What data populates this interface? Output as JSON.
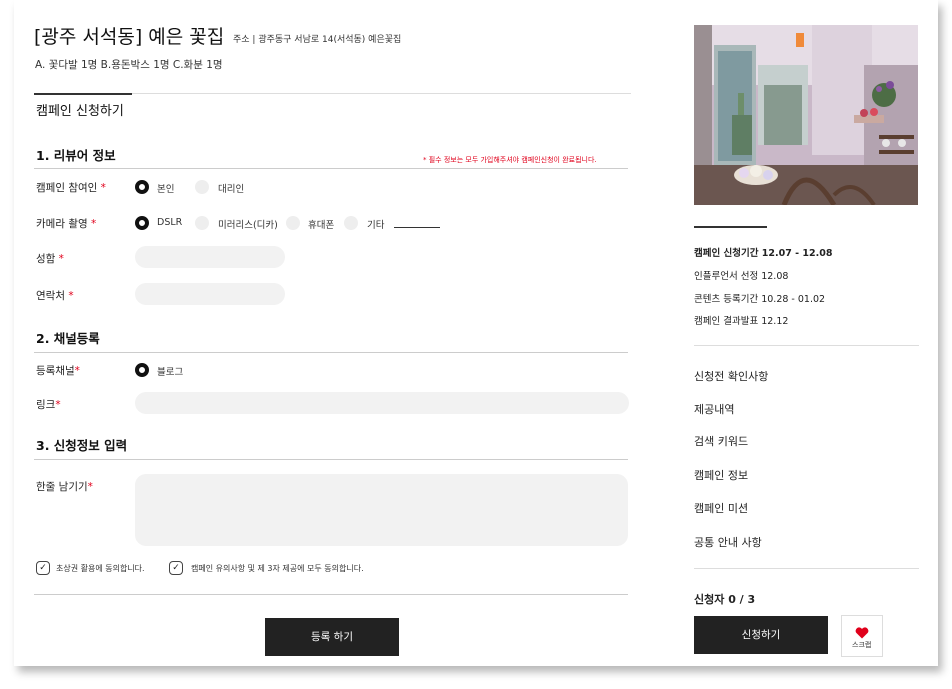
{
  "header": {
    "title": "[광주 서석동] 예은 꽃집",
    "address": "주소 | 광주동구 서남로 14(서석동) 예은꽃집",
    "rewards": "A. 꽃다발 1명 B.용돈박스 1명 C.화분 1명"
  },
  "tab_label": "캠페인 신청하기",
  "section1": {
    "heading": "1. 리뷰어 정보",
    "required_note": "* 필수 정보는 모두 가입해주셔야 캠페인신청이 완료됩니다.",
    "participant": {
      "label": "캠페인 참여인",
      "options": [
        "본인",
        "대리인"
      ],
      "selected": "본인"
    },
    "camera": {
      "label": "카메라 촬영",
      "options": [
        "DSLR",
        "미러리스(디카)",
        "휴대폰",
        "기타"
      ],
      "selected": "DSLR"
    },
    "name_label": "성함",
    "phone_label": "연락처",
    "required_mark": "*"
  },
  "section2": {
    "heading": "2. 채널등록",
    "channel": {
      "label": "등록채널",
      "option": "블로그"
    },
    "link_label": "링크"
  },
  "section3": {
    "heading": "3. 신청정보 입력",
    "comment_label": "한줄 남기기"
  },
  "agreements": [
    "초상권 활용에 동의합니다.",
    "캠페인 유의사항 및 제 3자 제공에 모두 동의합니다."
  ],
  "submit_label": "등록 하기",
  "sidebar": {
    "schedule": [
      {
        "label": "캠페인 신청기간 12.07 - 12.08",
        "bold": true
      },
      {
        "label": "인플루언서 선정 12.08",
        "bold": false
      },
      {
        "label": "콘텐츠 등록기간 10.28 - 01.02",
        "bold": false
      },
      {
        "label": "캠페인 결과발표 12.12",
        "bold": false
      }
    ],
    "menu": [
      "신청전 확인사항",
      "제공내역",
      "검색 키워드",
      "캠페인 정보",
      "캠페인 미션",
      "공통 안내 사항"
    ],
    "applicants": "신청자 0 / 3",
    "apply_label": "신청하기",
    "scrap_label": "스크랩"
  },
  "colors": {
    "accent": "#e0001b",
    "dark": "#222222",
    "field": "#f2f2f2"
  }
}
